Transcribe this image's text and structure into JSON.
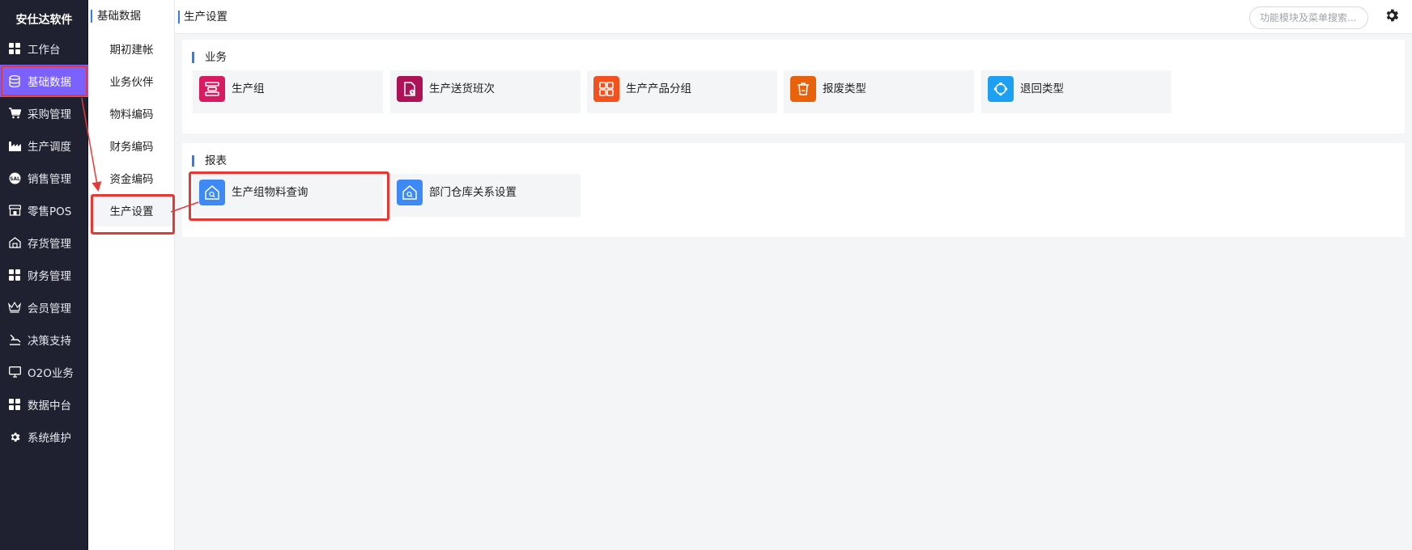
{
  "app": {
    "brand": "安仕达软件"
  },
  "sidebar": {
    "items": [
      {
        "label": "工作台",
        "icon": "grid-icon"
      },
      {
        "label": "基础数据",
        "icon": "database-icon",
        "active": true
      },
      {
        "label": "采购管理",
        "icon": "cart-icon"
      },
      {
        "label": "生产调度",
        "icon": "factory-icon"
      },
      {
        "label": "销售管理",
        "icon": "sales-icon"
      },
      {
        "label": "零售POS",
        "icon": "store-icon"
      },
      {
        "label": "存货管理",
        "icon": "warehouse-icon"
      },
      {
        "label": "财务管理",
        "icon": "grid-icon"
      },
      {
        "label": "会员管理",
        "icon": "crown-icon"
      },
      {
        "label": "决策支持",
        "icon": "decision-icon"
      },
      {
        "label": "O2O业务",
        "icon": "monitor-icon"
      },
      {
        "label": "数据中台",
        "icon": "grid-icon"
      },
      {
        "label": "系统维护",
        "icon": "gear-icon"
      }
    ]
  },
  "submenu": {
    "title": "基础数据",
    "items": [
      {
        "label": "期初建帐"
      },
      {
        "label": "业务伙伴"
      },
      {
        "label": "物料编码"
      },
      {
        "label": "财务编码"
      },
      {
        "label": "资金编码"
      },
      {
        "label": "生产设置",
        "active": true
      }
    ]
  },
  "header": {
    "title": "生产设置",
    "search_placeholder": "功能模块及菜单搜索..."
  },
  "sections": {
    "business": {
      "label": "业务",
      "cards": [
        {
          "label": "生产组",
          "icon": "production-group-icon",
          "color": "#d81b60"
        },
        {
          "label": "生产送货班次",
          "icon": "delivery-shift-icon",
          "color": "#ad1457"
        },
        {
          "label": "生产产品分组",
          "icon": "product-group-icon",
          "color": "#f4511e"
        },
        {
          "label": "报废类型",
          "icon": "trash-icon",
          "color": "#e8620c"
        },
        {
          "label": "退回类型",
          "icon": "return-icon",
          "color": "#1ea0f2"
        }
      ]
    },
    "reports": {
      "label": "报表",
      "cards": [
        {
          "label": "生产组物料查询",
          "icon": "home-search-icon",
          "color": "#3d8af7",
          "highlight": true
        },
        {
          "label": "部门仓库关系设置",
          "icon": "home-search-icon",
          "color": "#3d8af7"
        }
      ]
    }
  },
  "colors": {
    "accent": "#2f7cf6",
    "active_nav": "#7b61ff",
    "annotation": "#e53935",
    "sidebar_bg": "#1f2131"
  }
}
